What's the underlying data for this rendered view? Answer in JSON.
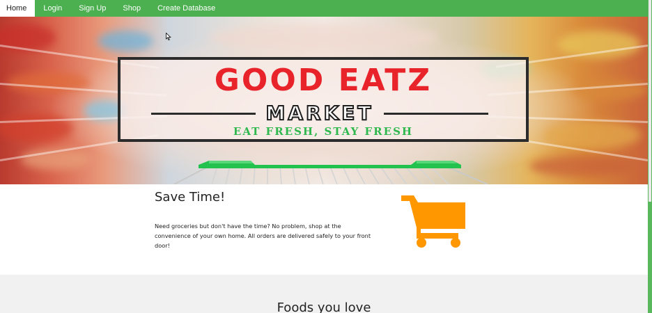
{
  "nav": {
    "items": [
      {
        "label": "Home",
        "active": true
      },
      {
        "label": "Login",
        "active": false
      },
      {
        "label": "Sign Up",
        "active": false
      },
      {
        "label": "Shop",
        "active": false
      },
      {
        "label": "Create Database",
        "active": false
      }
    ]
  },
  "hero": {
    "logo_title": "GOOD EATZ",
    "logo_subtitle": "MARKET",
    "logo_tagline": "EAT FRESH, STAY FRESH"
  },
  "feature": {
    "title": "Save Time!",
    "description": "Need groceries but don't have the time? No problem, shop at the convenience of your own home. All orders are delivered safely to your front door!",
    "icon": "shopping-cart-icon"
  },
  "foods": {
    "title": "Foods you love"
  },
  "colors": {
    "nav_bg": "#4caf50",
    "logo_red": "#e8232a",
    "logo_green": "#2fb84e",
    "cart_orange": "#ff9800",
    "foods_bg": "#f1f1f1"
  }
}
